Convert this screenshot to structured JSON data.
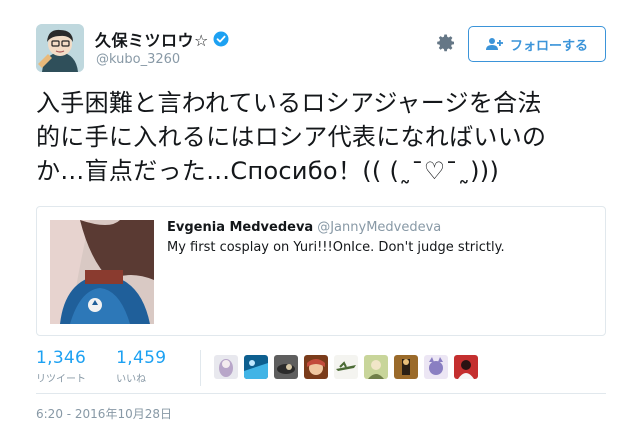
{
  "user": {
    "display_name": "久保ミツロウ☆",
    "handle": "@kubo_3260",
    "verified": true
  },
  "actions": {
    "follow_label": "フォローする",
    "settings_icon": "gear-icon"
  },
  "tweet": {
    "text_line1": "入手困難と言われているロシアジャージを合法",
    "text_line2": "的に手に入れるにはロシア代表になればいいの",
    "text_line3": "か…盲点だった…Спосибо！(( (˷¯♡¯˷)))"
  },
  "quote": {
    "author_name": "Evgenia Medvedeva",
    "author_handle": "@JannyMedvedeva",
    "text": "My first cosplay on Yuri!!!OnIce. Don't judge strictly."
  },
  "stats": {
    "retweets_count": "1,346",
    "retweets_label": "リツイート",
    "likes_count": "1,459",
    "likes_label": "いいね"
  },
  "liker_avatars": 9,
  "timestamp": "6:20 - 2016年10月28日",
  "colors": {
    "accent": "#1da1f2",
    "follow_border": "#3b94d9",
    "muted": "#8899a6",
    "border": "#e1e8ed"
  }
}
